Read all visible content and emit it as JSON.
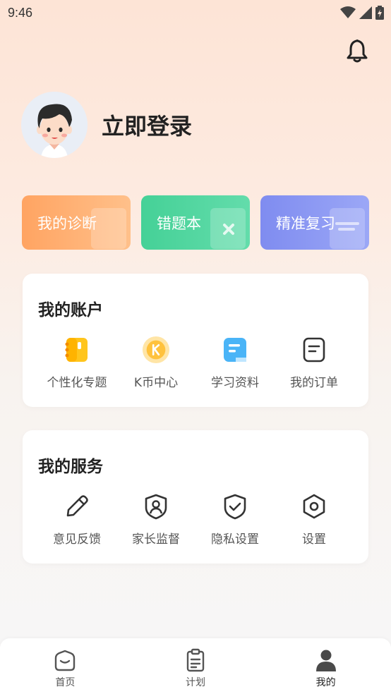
{
  "status_bar": {
    "time": "9:46"
  },
  "profile": {
    "login_label": "立即登录"
  },
  "quick_actions": [
    {
      "label": "我的诊断",
      "color": "#ffa462"
    },
    {
      "label": "错题本",
      "color": "#45d197"
    },
    {
      "label": "精准复习",
      "color": "#7f8cf0"
    }
  ],
  "account": {
    "title": "我的账户",
    "items": [
      {
        "label": "个性化专题",
        "icon": "notebook-icon"
      },
      {
        "label": "K币中心",
        "icon": "coin-icon"
      },
      {
        "label": "学习资料",
        "icon": "document-icon"
      },
      {
        "label": "我的订单",
        "icon": "order-icon"
      }
    ]
  },
  "service": {
    "title": "我的服务",
    "items": [
      {
        "label": "意见反馈",
        "icon": "pencil-icon"
      },
      {
        "label": "家长监督",
        "icon": "parent-shield-icon"
      },
      {
        "label": "隐私设置",
        "icon": "privacy-shield-icon"
      },
      {
        "label": "设置",
        "icon": "settings-icon"
      }
    ]
  },
  "tabbar": {
    "items": [
      {
        "label": "首页",
        "icon": "home-icon",
        "active": false
      },
      {
        "label": "计划",
        "icon": "plan-icon",
        "active": false
      },
      {
        "label": "我的",
        "icon": "profile-icon",
        "active": true
      }
    ]
  }
}
